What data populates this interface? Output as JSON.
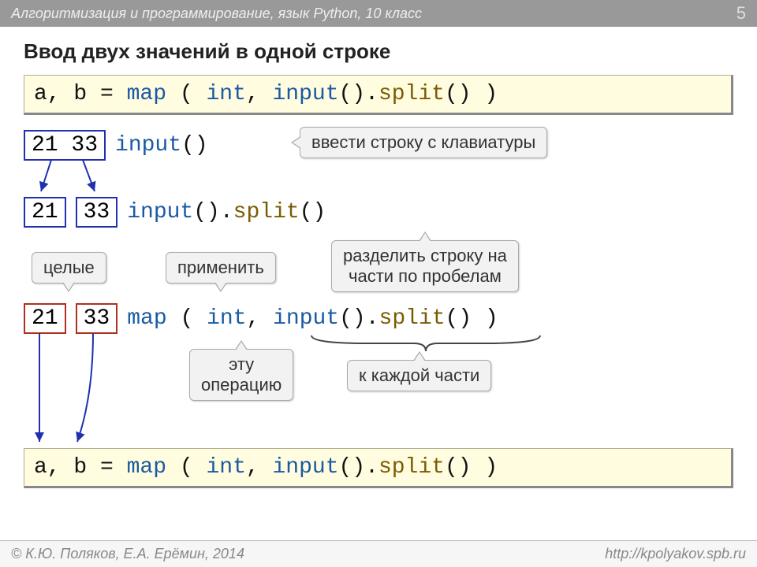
{
  "header": {
    "subject": "Алгоритмизация и программирование, язык Python, 10 класс",
    "page": "5"
  },
  "title": "Ввод двух значений в одной строке",
  "code": {
    "line1_a": "a, b = ",
    "map": "map",
    "int": "int",
    "input": "input",
    "split": "split",
    "paren_open": " ( ",
    "comma_sp": ", ",
    "call": "()",
    "dot": ".",
    "paren_close": " )"
  },
  "values": {
    "pair": "21 33",
    "v1": "21",
    "v2": "33"
  },
  "callouts": {
    "input": "ввести строку с клавиатуры",
    "split": "разделить строку на\nчасти по пробелам",
    "ints": "целые",
    "apply": "применить",
    "this_op": "эту\nоперацию",
    "each_part": "к каждой части"
  },
  "footer": {
    "left": "© К.Ю. Поляков, Е.А. Ерёмин, 2014",
    "right": "http://kpolyakov.spb.ru"
  }
}
